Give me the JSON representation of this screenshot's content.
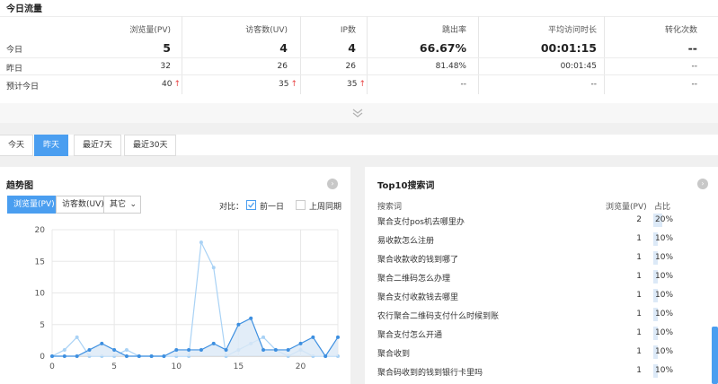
{
  "today_traffic": {
    "title": "今日流量",
    "columns": [
      "浏览量(PV)",
      "访客数(UV)",
      "IP数",
      "跳出率",
      "平均访问时长",
      "转化次数"
    ],
    "rows": [
      {
        "label": "今日",
        "values": [
          "5",
          "4",
          "4",
          "66.67%",
          "00:01:15",
          "--"
        ]
      },
      {
        "label": "昨日",
        "values": [
          "32",
          "26",
          "26",
          "81.48%",
          "00:01:45",
          "--"
        ]
      },
      {
        "label": "预计今日",
        "values": [
          "40",
          "35",
          "35",
          "--",
          "--",
          "--"
        ],
        "up": [
          "↑",
          "↑",
          "↑"
        ]
      }
    ],
    "collapse_icon": "double-chevron-down-icon"
  },
  "period_tabs": {
    "items": [
      "今天",
      "昨天",
      "最近7天",
      "最近30天"
    ],
    "active": "昨天"
  },
  "trend": {
    "title": "趋势图",
    "metric_tabs": [
      "浏览量(PV)",
      "访客数(UV)",
      "其它"
    ],
    "active_metric": "浏览量(PV)",
    "compare_label": "对比：",
    "compare_options": [
      {
        "label": "前一日",
        "checked": true
      },
      {
        "label": "上周同期",
        "checked": false
      }
    ],
    "more_icon": "chevron-right-icon"
  },
  "top10": {
    "title": "Top10搜索词",
    "headers": [
      "搜索词",
      "浏览量(PV)",
      "占比"
    ],
    "rows": [
      {
        "keyword": "聚合支付pos机去哪里办",
        "pv": "2",
        "share": "20%",
        "fraction": 0.2
      },
      {
        "keyword": "易收款怎么注册",
        "pv": "1",
        "share": "10%",
        "fraction": 0.1
      },
      {
        "keyword": "聚合收款收的钱到哪了",
        "pv": "1",
        "share": "10%",
        "fraction": 0.1
      },
      {
        "keyword": "聚合二维码怎么办理",
        "pv": "1",
        "share": "10%",
        "fraction": 0.1
      },
      {
        "keyword": "聚合支付收款钱去哪里",
        "pv": "1",
        "share": "10%",
        "fraction": 0.1
      },
      {
        "keyword": "农行聚合二维码支付什么时候到账",
        "pv": "1",
        "share": "10%",
        "fraction": 0.1
      },
      {
        "keyword": "聚合支付怎么开通",
        "pv": "1",
        "share": "10%",
        "fraction": 0.1
      },
      {
        "keyword": "聚合收到",
        "pv": "1",
        "share": "10%",
        "fraction": 0.1
      },
      {
        "keyword": "聚合码收到的钱到银行卡里吗",
        "pv": "1",
        "share": "10%",
        "fraction": 0.1
      }
    ],
    "more_icon": "chevron-right-icon"
  },
  "chart_data": {
    "type": "area",
    "x": [
      0,
      1,
      2,
      3,
      4,
      5,
      6,
      7,
      8,
      9,
      10,
      11,
      12,
      13,
      14,
      15,
      16,
      17,
      18,
      19,
      20,
      21,
      22,
      23
    ],
    "xticks": [
      "0",
      "5",
      "10",
      "15",
      "20"
    ],
    "xtick_values": [
      0,
      5,
      10,
      15,
      20
    ],
    "yticks": [
      "0",
      "5",
      "10",
      "15",
      "20"
    ],
    "ylim": [
      0,
      20
    ],
    "xlim": [
      0,
      23
    ],
    "series": [
      {
        "values": [
          0,
          0,
          0,
          1,
          2,
          1,
          0,
          0,
          0,
          0,
          1,
          1,
          1,
          2,
          1,
          5,
          6,
          1,
          1,
          1,
          2,
          3,
          0,
          3
        ],
        "color": "#3d8fe0",
        "fill": true
      },
      {
        "values": [
          0,
          1,
          3,
          0,
          0,
          0,
          1,
          0,
          0,
          0,
          0,
          0,
          18,
          14,
          0,
          1,
          2,
          3,
          1,
          0,
          1,
          0,
          0,
          0
        ],
        "color": "#a9d2f5",
        "fill": false
      }
    ]
  }
}
